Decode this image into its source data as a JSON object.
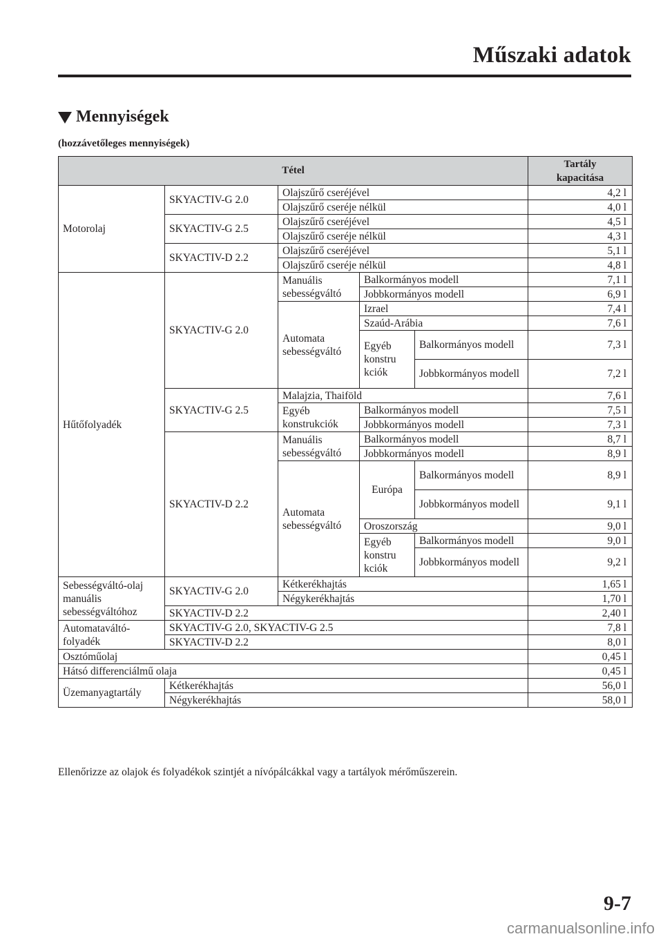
{
  "header": {
    "title": "Műszaki adatok"
  },
  "section": {
    "title": "Mennyiségek",
    "subtitle": "(hozzávetőleges mennyiségek)"
  },
  "table": {
    "col_item": "Tétel",
    "col_capacity": "Tartály\nkapacitása",
    "motor": {
      "label": "Motorolaj",
      "g20": "SKYACTIV-G 2.0",
      "g25": "SKYACTIV-G 2.5",
      "d22": "SKYACTIV-D 2.2",
      "with_filter": "Olajszűrő cseréjével",
      "without_filter": "Olajszűrő cseréje nélkül",
      "v": [
        "4,2 l",
        "4,0 l",
        "4,5 l",
        "4,3 l",
        "5,1 l",
        "4,8 l"
      ]
    },
    "cool": {
      "label": "Hűtőfolyadék",
      "g20": "SKYACTIV-G 2.0",
      "g25": "SKYACTIV-G 2.5",
      "d22": "SKYACTIV-D 2.2",
      "manual": "Manuális sebességváltó",
      "auto": "Automata sebességváltó",
      "lhd": "Balkormányos modell",
      "rhd": "Jobbkormányos modell",
      "israel": "Izrael",
      "saudi": "Szaúd-Arábia",
      "other_split": "Egyéb konstru kciók",
      "malay": "Malajzia, Thaiföld",
      "other": "Egyéb konstrukciók",
      "europe": "Európa",
      "russia": "Oroszország",
      "v": [
        "7,1 l",
        "6,9 l",
        "7,4 l",
        "7,6 l",
        "7,3 l",
        "7,2 l",
        "7,6 l",
        "7,5 l",
        "7,3 l",
        "8,7 l",
        "8,9 l",
        "8,9 l",
        "9,1 l",
        "9,0 l",
        "9,0 l",
        "9,2 l"
      ]
    },
    "mtoil": {
      "label": "Sebességváltó-olaj manuális sebességváltóhoz",
      "g20": "SKYACTIV-G 2.0",
      "d22": "SKYACTIV-D 2.2",
      "twowd": "Kétkerékhajtás",
      "fourwd": "Négykerékhajtás",
      "v": [
        "1,65 l",
        "1,70 l",
        "2,40 l"
      ]
    },
    "atf": {
      "label": "Automataváltó-folyadék",
      "g": "SKYACTIV-G 2.0, SKYACTIV-G 2.5",
      "d": "SKYACTIV-D 2.2",
      "v": [
        "7,8 l",
        "8,0 l"
      ]
    },
    "transfer": {
      "label": "Osztóműolaj",
      "v": "0,45 l"
    },
    "rear_diff": {
      "label": "Hátsó differenciálmű olaja",
      "v": "0,45 l"
    },
    "fuel": {
      "label": "Üzemanyagtartály",
      "twowd": "Kétkerékhajtás",
      "fourwd": "Négykerékhajtás",
      "v": [
        "56,0 l",
        "58,0 l"
      ]
    }
  },
  "note": "Ellenőrizze az olajok és folyadékok szintjét a nívópálcákkal vagy a tartályok mérőműszerein.",
  "page_number": "9-7",
  "watermark": "carmanualsonline.info"
}
